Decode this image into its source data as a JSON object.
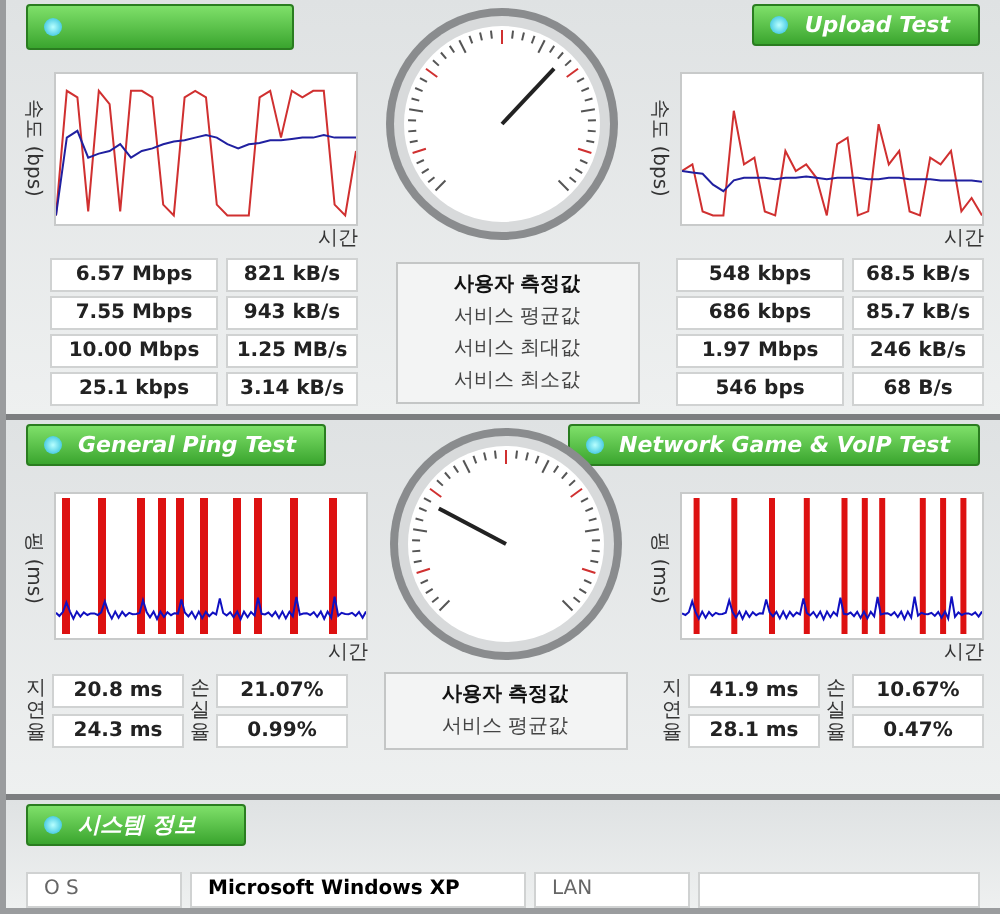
{
  "speed_test": {
    "upload_button": {
      "label": "Upload Test"
    },
    "left_chart": {
      "ylabel": "속도 (bps)",
      "xlabel": "시간"
    },
    "right_chart": {
      "ylabel": "속도 (bps)",
      "xlabel": "시간"
    },
    "gauge": {
      "level": 0.66
    },
    "rows": [
      {
        "label": "사용자 측정값",
        "highlighted": true,
        "left": [
          "6.57 Mbps",
          "821 kB/s"
        ],
        "right": [
          "548 kbps",
          "68.5 kB/s"
        ]
      },
      {
        "label": "서비스 평균값",
        "highlighted": false,
        "left": [
          "7.55 Mbps",
          "943 kB/s"
        ],
        "right": [
          "686 kbps",
          "85.7 kB/s"
        ]
      },
      {
        "label": "서비스 최대값",
        "highlighted": false,
        "left": [
          "10.00 Mbps",
          "1.25 MB/s"
        ],
        "right": [
          "1.97 Mbps",
          "246 kB/s"
        ]
      },
      {
        "label": "서비스 최소값",
        "highlighted": false,
        "left": [
          "25.1 kbps",
          "3.14 kB/s"
        ],
        "right": [
          "546 bps",
          "68 B/s"
        ]
      }
    ]
  },
  "ping_test": {
    "left_button": {
      "label": "General Ping Test"
    },
    "right_button": {
      "label": "Network Game & VoIP Test"
    },
    "left_chart": {
      "ylabel": "핑 (ms)",
      "xlabel": "시간"
    },
    "right_chart": {
      "ylabel": "핑 (ms)",
      "xlabel": "시간"
    },
    "gauge": {
      "level": 0.27
    },
    "left_latency_label": "지연율",
    "left_loss_label": "손실율",
    "right_latency_label": "지연율",
    "right_loss_label": "손실율",
    "rows": [
      {
        "label": "사용자 측정값",
        "highlighted": true,
        "left_latency": "20.8 ms",
        "left_loss": "21.07%",
        "right_latency": "41.9 ms",
        "right_loss": "10.67%"
      },
      {
        "label": "서비스 평균값",
        "highlighted": false,
        "left_latency": "24.3 ms",
        "left_loss": "0.99%",
        "right_latency": "28.1 ms",
        "right_loss": "0.47%"
      }
    ]
  },
  "system_info": {
    "button": {
      "label": "시스템 정보"
    },
    "rows": [
      {
        "label": "O S",
        "value": "Microsoft Windows XP",
        "label_2": "LAN"
      }
    ]
  }
}
